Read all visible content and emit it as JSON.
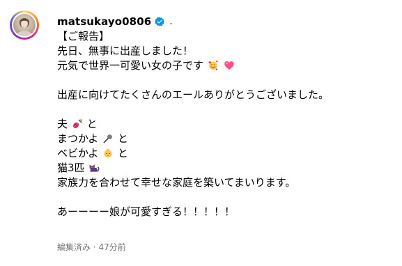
{
  "post": {
    "username": "matsukayo0806",
    "verified_icon": "verified-badge-icon",
    "separator": ".",
    "caption_lines": [
      "【ご報告】",
      "先日、無事に出産しました！",
      "元気で世界一可愛い女の子です",
      "",
      "出産に向けてたくさんのエールありがとうございました。",
      "",
      "夫",
      "まつかよ",
      "ベビかよ",
      "猫3匹",
      "家族力を合わせて幸せな家庭を築いてまいります。",
      "",
      "あーーーー娘が可愛すぎる！！！！！"
    ],
    "line_tail": "と",
    "emojis": {
      "line3": [
        "smiling-face-with-hearts-icon",
        "pink-heart-icon"
      ],
      "husband": "guitar-icon",
      "matsukayo": "microphone-icon",
      "baby": "baby-icon",
      "cats": "black-cat-icon"
    },
    "meta": {
      "edited": "編集済み",
      "dot": "·",
      "time": "47分前"
    },
    "colors": {
      "verified": "#0095f6",
      "meta_text": "#737373",
      "heart": "#ff4f8b"
    }
  }
}
